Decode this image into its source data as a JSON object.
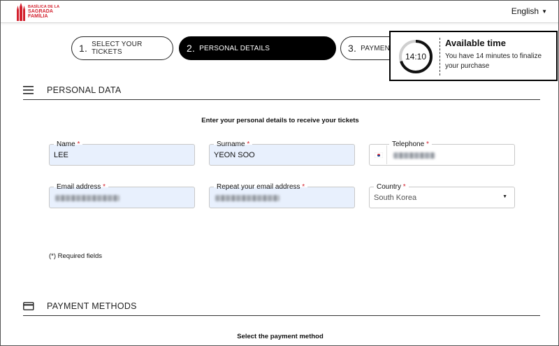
{
  "header": {
    "logo": {
      "line1": "BASÍLICA DE LA",
      "line2": "SAGRADA",
      "line3": "FAMÍLIA"
    },
    "language": "English"
  },
  "steps": [
    {
      "num": "1.",
      "label": "SELECT YOUR TICKETS",
      "active": false
    },
    {
      "num": "2.",
      "label": "PERSONAL DETAILS",
      "active": true
    },
    {
      "num": "3.",
      "label": "PAYMENT",
      "active": false
    }
  ],
  "timer": {
    "time": "14:10",
    "title": "Available time",
    "message": "You have 14 minutes to finalize your purchase",
    "remaining_fraction": 0.7
  },
  "personal": {
    "title": "PERSONAL DATA",
    "subtitle": "Enter your personal details to receive your tickets",
    "fields": {
      "name": {
        "label": "Name",
        "value": "LEE"
      },
      "surname": {
        "label": "Surname",
        "value": "YEON SOO"
      },
      "telephone": {
        "label": "Telephone",
        "value": ""
      },
      "email": {
        "label": "Email address",
        "value": ""
      },
      "repeat_email": {
        "label": "Repeat your email address",
        "value": ""
      },
      "country": {
        "label": "Country",
        "value": "South Korea"
      }
    },
    "required_marker": "*",
    "required_note": "(*) Required fields"
  },
  "payment": {
    "title": "PAYMENT METHODS",
    "subtitle": "Select the payment method"
  },
  "colors": {
    "accent": "#d3202d",
    "filled_bg": "#e8f0fd",
    "dark": "#000000"
  },
  "icons": {
    "menu": "menu-icon",
    "card": "credit-card-icon",
    "flag": "korea-flag-icon",
    "caret": "caret-down-icon"
  }
}
